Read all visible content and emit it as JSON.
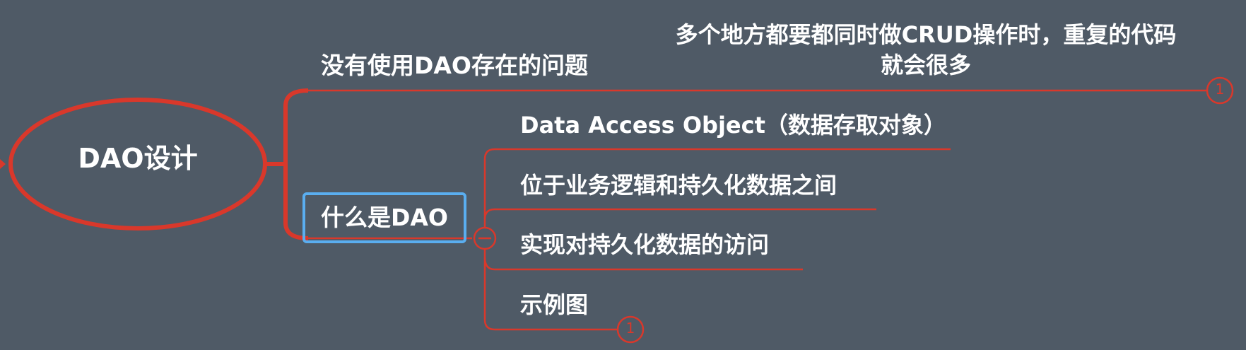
{
  "root": {
    "label": "DAO设计"
  },
  "branches": [
    {
      "label": "没有使用DAO存在的问题",
      "note": "多个地方都要都同时做CRUD操作时，重复的代码就会很多",
      "collapsed_count": "1"
    },
    {
      "label": "什么是DAO",
      "collapse_symbol": "−",
      "children": [
        {
          "label": "Data Access Object（数据存取对象）"
        },
        {
          "label": "位于业务逻辑和持久化数据之间"
        },
        {
          "label": "实现对持久化数据的访问"
        },
        {
          "label": "示例图",
          "collapsed_count": "1"
        }
      ]
    }
  ],
  "colors": {
    "background": "#4f5a66",
    "line": "#d9382b",
    "selection": "#5aaef0",
    "text": "#ffffff"
  }
}
